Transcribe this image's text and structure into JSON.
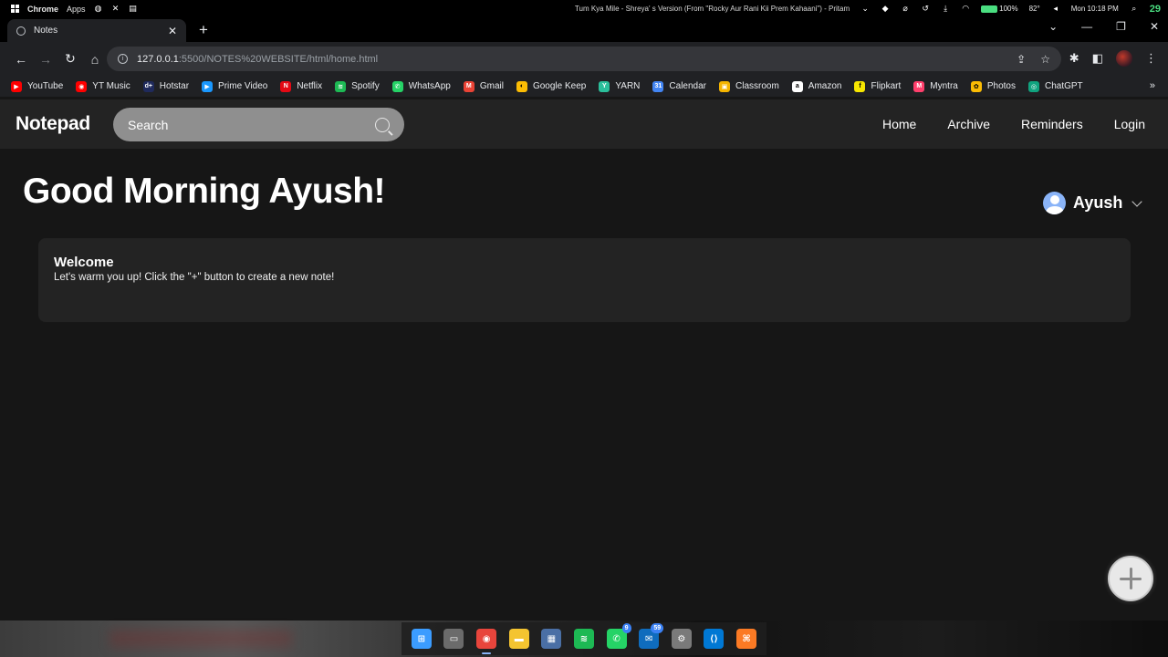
{
  "os_bar": {
    "app_name": "Chrome",
    "apps_label": "Apps",
    "media_title": "Tum Kya Mile - Shreya' s Version (From \"Rocky Aur Rani Kii Prem Kahaani\") - Pritam",
    "battery": "100%",
    "weather": "82°",
    "clock": "Mon 10:18 PM",
    "corner_number": "29"
  },
  "browser": {
    "tab_title": "Notes",
    "new_tab_symbol": "+",
    "url_host": "127.0.0.1",
    "url_path": ":5500/NOTES%20WEBSITE/html/home.html",
    "bookmarks": [
      {
        "label": "YouTube",
        "color": "#ff0000",
        "glyph": "▶"
      },
      {
        "label": "YT Music",
        "color": "#ff0000",
        "glyph": "◉"
      },
      {
        "label": "Hotstar",
        "color": "#1f2a5c",
        "glyph": "d+"
      },
      {
        "label": "Prime Video",
        "color": "#1a98ff",
        "glyph": "▶"
      },
      {
        "label": "Netflix",
        "color": "#e50914",
        "glyph": "N"
      },
      {
        "label": "Spotify",
        "color": "#1db954",
        "glyph": "≋"
      },
      {
        "label": "WhatsApp",
        "color": "#25d366",
        "glyph": "✆"
      },
      {
        "label": "Gmail",
        "color": "#ea4335",
        "glyph": "M"
      },
      {
        "label": "Google Keep",
        "color": "#fbbc04",
        "glyph": "◐"
      },
      {
        "label": "YARN",
        "color": "#2bbf9b",
        "glyph": "Y"
      },
      {
        "label": "Calendar",
        "color": "#4285f4",
        "glyph": "31"
      },
      {
        "label": "Classroom",
        "color": "#f4b400",
        "glyph": "▣"
      },
      {
        "label": "Amazon",
        "color": "#ffffff",
        "glyph": "a"
      },
      {
        "label": "Flipkart",
        "color": "#f7e600",
        "glyph": "f"
      },
      {
        "label": "Myntra",
        "color": "#ff3f6c",
        "glyph": "M"
      },
      {
        "label": "Photos",
        "color": "#fbbc04",
        "glyph": "✿"
      },
      {
        "label": "ChatGPT",
        "color": "#10a37f",
        "glyph": "◎"
      }
    ],
    "bookmarks_more": "»"
  },
  "app": {
    "brand": "Notepad",
    "search_placeholder": "Search",
    "nav": {
      "home": "Home",
      "archive": "Archive",
      "reminders": "Reminders",
      "login": "Login"
    },
    "greeting": "Good Morning Ayush!",
    "user_name": "Ayush",
    "note": {
      "title": "Welcome",
      "body": "Let's warm you up! Click the \"+\" button to create a new note!"
    }
  },
  "taskbar": {
    "items": [
      {
        "name": "start",
        "color": "#3b9cff",
        "glyph": "⊞"
      },
      {
        "name": "task-view",
        "color": "#6b6b6b",
        "glyph": "▭"
      },
      {
        "name": "chrome",
        "color": "#e8453c",
        "glyph": "◉"
      },
      {
        "name": "file-explorer",
        "color": "#f4c430",
        "glyph": "▬"
      },
      {
        "name": "calculator",
        "color": "#4a6fa5",
        "glyph": "▦"
      },
      {
        "name": "spotify",
        "color": "#1db954",
        "glyph": "≋"
      },
      {
        "name": "whatsapp",
        "color": "#25d366",
        "glyph": "✆",
        "badge": "9"
      },
      {
        "name": "outlook",
        "color": "#0f6cbd",
        "glyph": "✉",
        "badge": "59"
      },
      {
        "name": "settings",
        "color": "#7a7a7a",
        "glyph": "⚙"
      },
      {
        "name": "vscode",
        "color": "#0078d4",
        "glyph": "⟨⟩"
      },
      {
        "name": "xampp",
        "color": "#fb7a24",
        "glyph": "⌘"
      }
    ]
  }
}
